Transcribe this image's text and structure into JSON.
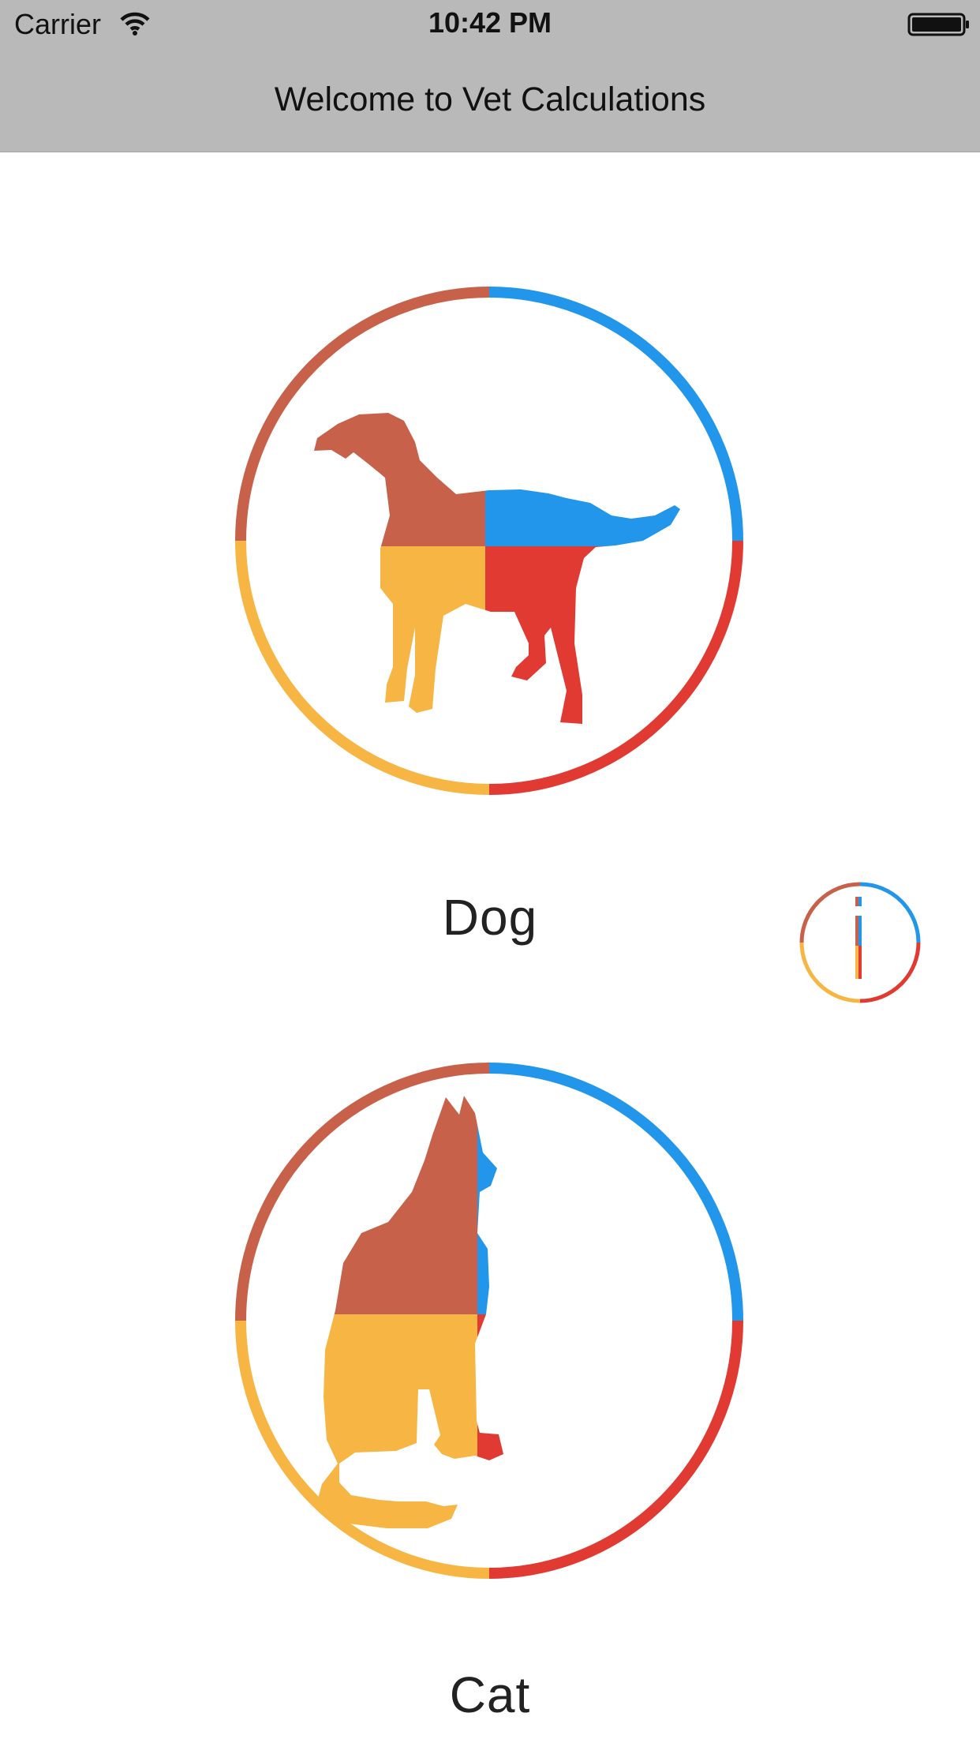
{
  "status_bar": {
    "carrier": "Carrier",
    "time": "10:42 PM",
    "wifi_icon": "wifi-icon",
    "battery_icon": "battery-icon"
  },
  "nav_bar": {
    "title": "Welcome to Vet Calculations"
  },
  "animals": [
    {
      "label": "Dog",
      "icon": "dog-icon"
    },
    {
      "label": "Cat",
      "icon": "cat-icon"
    }
  ],
  "info_button": {
    "icon": "info-icon"
  },
  "colors": {
    "brown": "#c8614a",
    "blue": "#2196ea",
    "red": "#e03a33",
    "yellow": "#f7b543",
    "bar": "#b9b9b9"
  }
}
